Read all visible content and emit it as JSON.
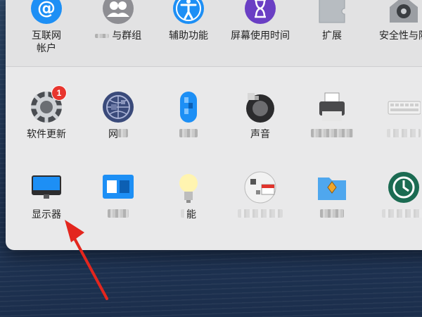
{
  "top_row": [
    {
      "label": "互联网\n帐户",
      "icon": "at-icon"
    },
    {
      "label": "与群组",
      "icon": "users-icon",
      "partial_prefix": true
    },
    {
      "label": "辅助功能",
      "icon": "accessibility-icon"
    },
    {
      "label": "屏幕使用时间",
      "icon": "hourglass-icon"
    },
    {
      "label": "扩展",
      "icon": "puzzle-icon"
    },
    {
      "label": "安全性与隐",
      "icon": "house-lock-icon"
    }
  ],
  "middle_row": [
    {
      "label": "软件更新",
      "icon": "gear-icon",
      "badge": "1"
    },
    {
      "label": "网",
      "icon": "network-globe-icon",
      "pixelated": true
    },
    {
      "label": "",
      "icon": "bluetooth-icon",
      "pixelated": true
    },
    {
      "label": "声音",
      "icon": "speaker-icon"
    },
    {
      "label": "",
      "icon": "printer-icon",
      "pixelated": true
    },
    {
      "label": "",
      "icon": "keyboard-icon",
      "pixelated": true
    }
  ],
  "bottom_row": [
    {
      "label": "显示器",
      "icon": "display-icon"
    },
    {
      "label": "",
      "icon": "sidecar-icon",
      "pixelated": true
    },
    {
      "label": "能",
      "icon": "bulb-icon",
      "pixelated": true
    },
    {
      "label": "",
      "icon": "date-time-icon",
      "pixelated": true
    },
    {
      "label": "",
      "icon": "sharing-folder-icon",
      "pixelated": true
    },
    {
      "label": "",
      "icon": "time-machine-icon",
      "pixelated": true
    }
  ],
  "annotation": {
    "arrow_color": "#e3261e"
  },
  "colors": {
    "window_bg": "#e9e9ea",
    "badge": "#e8352e",
    "accent_blue": "#1d8ff5"
  }
}
